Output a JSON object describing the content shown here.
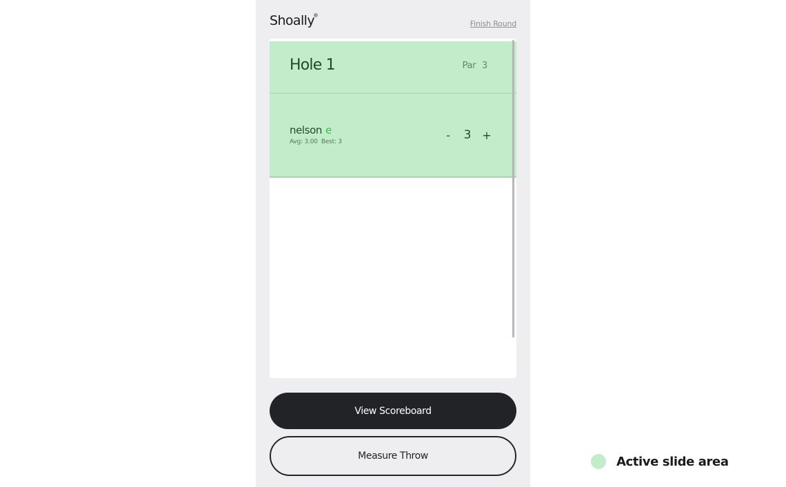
{
  "app": {
    "logo_text": "Shoally",
    "finish_label": "Finish Round"
  },
  "hole": {
    "title": "Hole 1",
    "par_label": "Par",
    "par_value": "3"
  },
  "players": [
    {
      "name": "nelson",
      "relative_score": "e",
      "avg_label": "Avg: 3.00",
      "best_label": "Best: 3",
      "score": "3",
      "minus_label": "-",
      "plus_label": "+"
    }
  ],
  "actions": {
    "scoreboard_label": "View Scoreboard",
    "measure_label": "Measure Throw"
  },
  "legend": {
    "label": "Active slide area",
    "color": "#c3ecca"
  },
  "colors": {
    "active_area": "#c3ecca",
    "dark_button": "#222326",
    "score_positive_accent": "#3dbb58"
  }
}
